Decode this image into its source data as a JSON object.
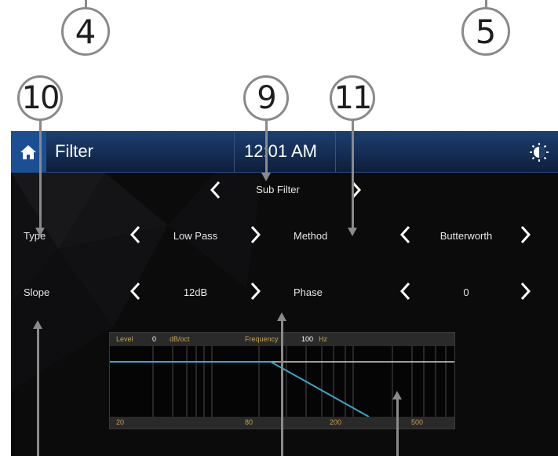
{
  "callouts": {
    "c4": "4",
    "c5": "5",
    "c10": "10",
    "c9": "9",
    "c11": "11"
  },
  "header": {
    "title": "Filter",
    "time": "12:01 AM"
  },
  "selector": {
    "value": "Sub Filter"
  },
  "settings": {
    "type": {
      "label": "Type",
      "value": "Low Pass"
    },
    "method": {
      "label": "Method",
      "value": "Butterworth"
    },
    "slope": {
      "label": "Slope",
      "value": "12dB"
    },
    "phase": {
      "label": "Phase",
      "value": "0"
    }
  },
  "graph": {
    "level_label": "Level",
    "level_value": "0",
    "level_unit": "dB/oct",
    "frequency_label": "Frequency",
    "frequency_value": "100",
    "frequency_unit": "Hz",
    "x_ticks": [
      "20",
      "80",
      "200",
      "500"
    ]
  },
  "colors": {
    "accent_blue": "#1b4f94",
    "curve": "#3aa6c8",
    "gold_text": "#c9a24a",
    "callout_border": "#8a8a8a"
  },
  "icons": {
    "home": "home-icon",
    "brightness": "brightness-icon",
    "prev": "chevron-left-icon",
    "next": "chevron-right-icon"
  }
}
